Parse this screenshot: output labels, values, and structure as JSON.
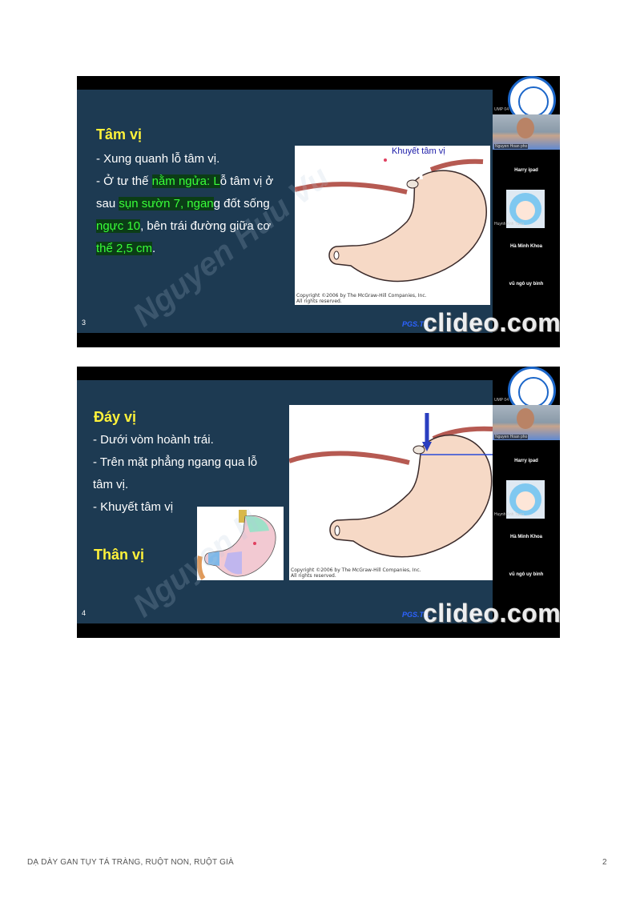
{
  "footer": {
    "left": "DẠ DÀY GAN TỤY TÁ TRÀNG, RUỘT NON, RUỘT GIÀ",
    "page": "2"
  },
  "slide1": {
    "title": "Tâm vị",
    "line1": "- Xung quanh lỗ tâm vị.",
    "line2_a": "- Ở tư thế ",
    "line2_b": "nằm ngửa: L",
    "line2_c": "ỗ tâm vị ở",
    "line3_a": "sau ",
    "line3_b": "sụn sườn 7, ngan",
    "line3_c": "g đốt sống",
    "line4_a": "ngực 10",
    "line4_b": ", bên trái đường giữa cơ",
    "line5_a": "thể 2,5 cm",
    "line5_b": ".",
    "figure_label": "Khuyết tâm vị",
    "copyright1": "Copyright ©2006 by The McGraw-Hill Companies, Inc.",
    "copyright2": "All rights reserved.",
    "slide_number": "3",
    "credit": "PGS.TS.",
    "brand": "clideo.com",
    "watermark": "Nguyen Huu Vu"
  },
  "slide2": {
    "title1": "Đáy vị",
    "line1": "- Dưới vòm hoành trái.",
    "line2": "- Trên mặt phẳng ngang qua lỗ",
    "line3": "tâm vị.",
    "line4": "- Khuyết tâm vị",
    "title2": "Thân vị",
    "copyright1": "Copyright ©2006 by The McGraw-Hill Companies, Inc.",
    "copyright2": "All rights reserved.",
    "slide_number": "4",
    "credit": "PGS.TS.",
    "brand": "clideo.com",
    "watermark": "Nguyen H"
  },
  "participants": {
    "umpf": "UMP 04",
    "cam_label": "Nguyen Hoan pho",
    "p1": "Harry ipad",
    "cam2_label": "Huynh Anh Tuan",
    "p2": "Hà Minh Khoa",
    "p3": "vũ ngô uy bình"
  }
}
